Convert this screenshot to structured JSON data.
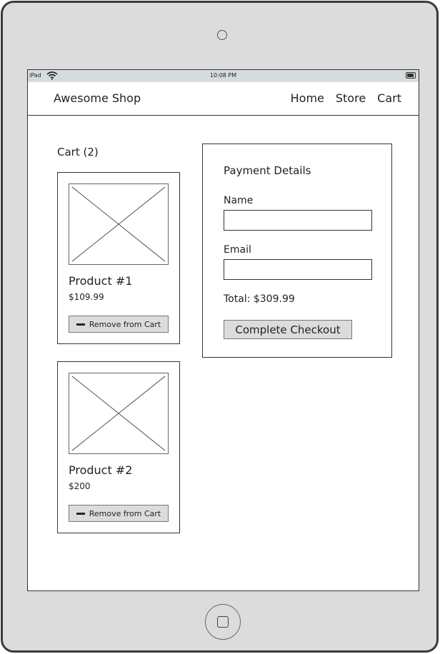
{
  "device": {
    "statusbar": {
      "carrier": "iPad",
      "wifi_icon": "wifi-icon",
      "time": "10:08 PM",
      "battery_icon": "battery-icon"
    }
  },
  "navbar": {
    "brand": "Awesome Shop",
    "links": [
      {
        "label": "Home"
      },
      {
        "label": "Store"
      },
      {
        "label": "Cart"
      }
    ]
  },
  "cart": {
    "title": "Cart (2)",
    "items": [
      {
        "name": "Product #1",
        "price": "$109.99",
        "image_icon": "image-placeholder-icon",
        "remove_label": "Remove from Cart",
        "remove_icon": "minus-icon"
      },
      {
        "name": "Product #2",
        "price": "$200",
        "image_icon": "image-placeholder-icon",
        "remove_label": "Remove from Cart",
        "remove_icon": "minus-icon"
      }
    ]
  },
  "payment": {
    "title": "Payment Details",
    "name_label": "Name",
    "name_value": "",
    "email_label": "Email",
    "email_value": "",
    "total": "Total: $309.99",
    "checkout_label": "Complete Checkout"
  }
}
